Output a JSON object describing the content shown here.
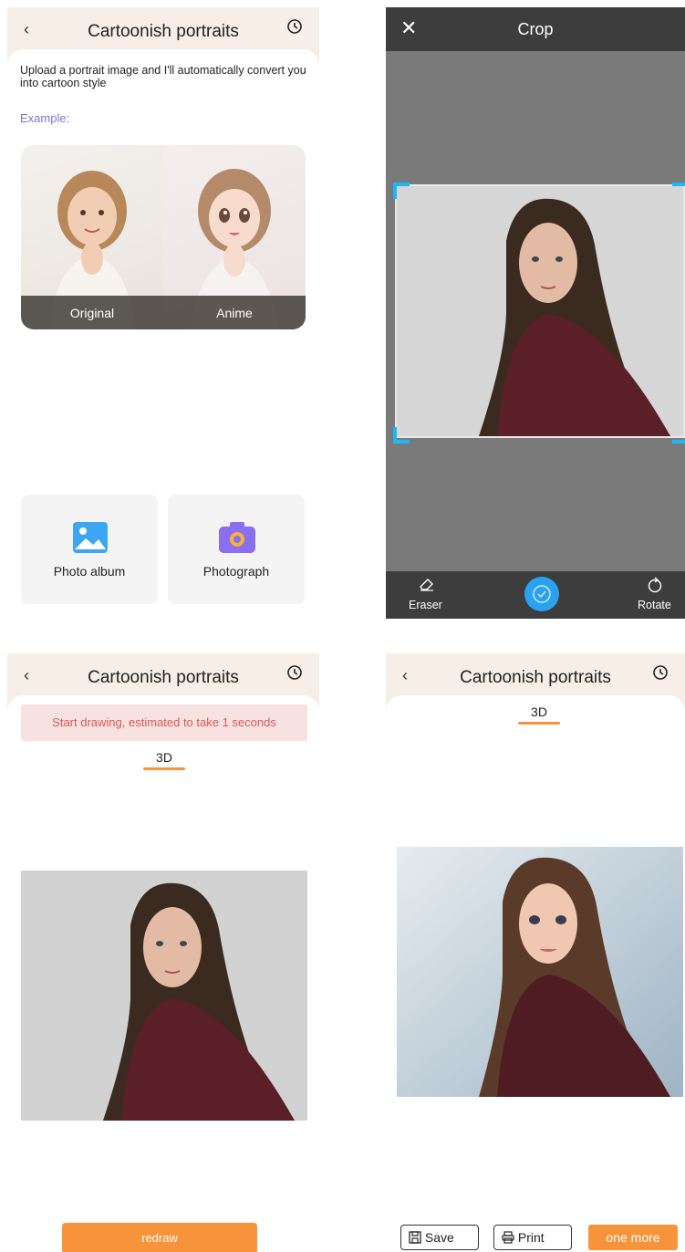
{
  "screen1": {
    "title": "Cartoonish portraits",
    "description": "Upload a portrait image and I'll automatically convert you into cartoon style",
    "example_label": "Example:",
    "example_left": "Original",
    "example_right": "Anime",
    "options": [
      {
        "label": "Photo album",
        "icon": "image-icon",
        "color": "#3da6f2"
      },
      {
        "label": "Photograph",
        "icon": "camera-icon",
        "color": "#8a6ff0"
      }
    ]
  },
  "screen2": {
    "title": "Crop",
    "left_tool": "Eraser",
    "right_tool": "Rotate",
    "accent": "#1fb6f5"
  },
  "screen3": {
    "title": "Cartoonish portraits",
    "notice": "Start drawing, estimated to take 1 seconds",
    "tab": "3D",
    "button": "redraw"
  },
  "screen4": {
    "title": "Cartoonish portraits",
    "tab": "3D",
    "save": "Save",
    "print": "Print",
    "more": "one more"
  },
  "colors": {
    "orange": "#f7943b",
    "header": "#f7efe7",
    "purple": "#7b73d8"
  }
}
